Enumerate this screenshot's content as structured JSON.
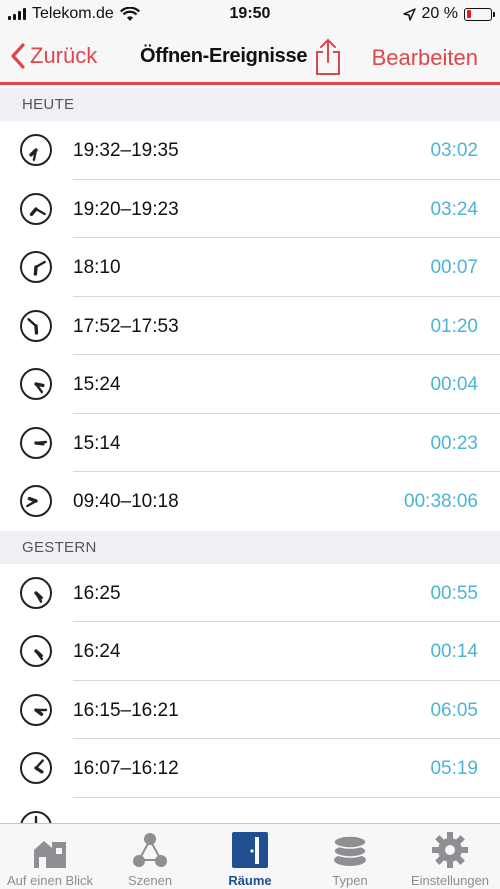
{
  "status": {
    "carrier": "Telekom.de",
    "time": "19:50",
    "battery": "20 %",
    "battery_level": 0.2,
    "icons": [
      "signal-icon",
      "wifi-icon",
      "location-arrow-icon",
      "battery-icon"
    ]
  },
  "nav": {
    "back_label": "Zurück",
    "title": "Öffnen-Ereignisse",
    "edit_label": "Bearbeiten",
    "accent": "#e0454b"
  },
  "sections": [
    {
      "header": "HEUTE",
      "rows": [
        {
          "time": "19:32–19:35",
          "duration": "03:02",
          "clock_hour": 19,
          "clock_minute": 32
        },
        {
          "time": "19:20–19:23",
          "duration": "03:24",
          "clock_hour": 19,
          "clock_minute": 20
        },
        {
          "time": "18:10",
          "duration": "00:07",
          "clock_hour": 18,
          "clock_minute": 10
        },
        {
          "time": "17:52–17:53",
          "duration": "01:20",
          "clock_hour": 17,
          "clock_minute": 52
        },
        {
          "time": "15:24",
          "duration": "00:04",
          "clock_hour": 15,
          "clock_minute": 24
        },
        {
          "time": "15:14",
          "duration": "00:23",
          "clock_hour": 15,
          "clock_minute": 14
        },
        {
          "time": "09:40–10:18",
          "duration": "00:38:06",
          "clock_hour": 9,
          "clock_minute": 40
        }
      ]
    },
    {
      "header": "GESTERN",
      "rows": [
        {
          "time": "16:25",
          "duration": "00:55",
          "clock_hour": 16,
          "clock_minute": 25
        },
        {
          "time": "16:24",
          "duration": "00:14",
          "clock_hour": 16,
          "clock_minute": 24
        },
        {
          "time": "16:15–16:21",
          "duration": "06:05",
          "clock_hour": 16,
          "clock_minute": 15
        },
        {
          "time": "16:07–16:12",
          "duration": "05:19",
          "clock_hour": 16,
          "clock_minute": 7
        },
        {
          "time": "",
          "duration": "",
          "clock_hour": 16,
          "clock_minute": 0
        }
      ]
    }
  ],
  "tabs": [
    {
      "label": "Auf einen Blick",
      "icon": "house-icon",
      "active": false
    },
    {
      "label": "Szenen",
      "icon": "scenes-icon",
      "active": false
    },
    {
      "label": "Räume",
      "icon": "door-icon",
      "active": true
    },
    {
      "label": "Typen",
      "icon": "layers-icon",
      "active": false
    },
    {
      "label": "Einstellungen",
      "icon": "gear-icon",
      "active": false
    }
  ],
  "colors": {
    "duration": "#4db4d4",
    "active_tab": "#1f4f8f",
    "inactive_tab": "#8e8e93"
  }
}
